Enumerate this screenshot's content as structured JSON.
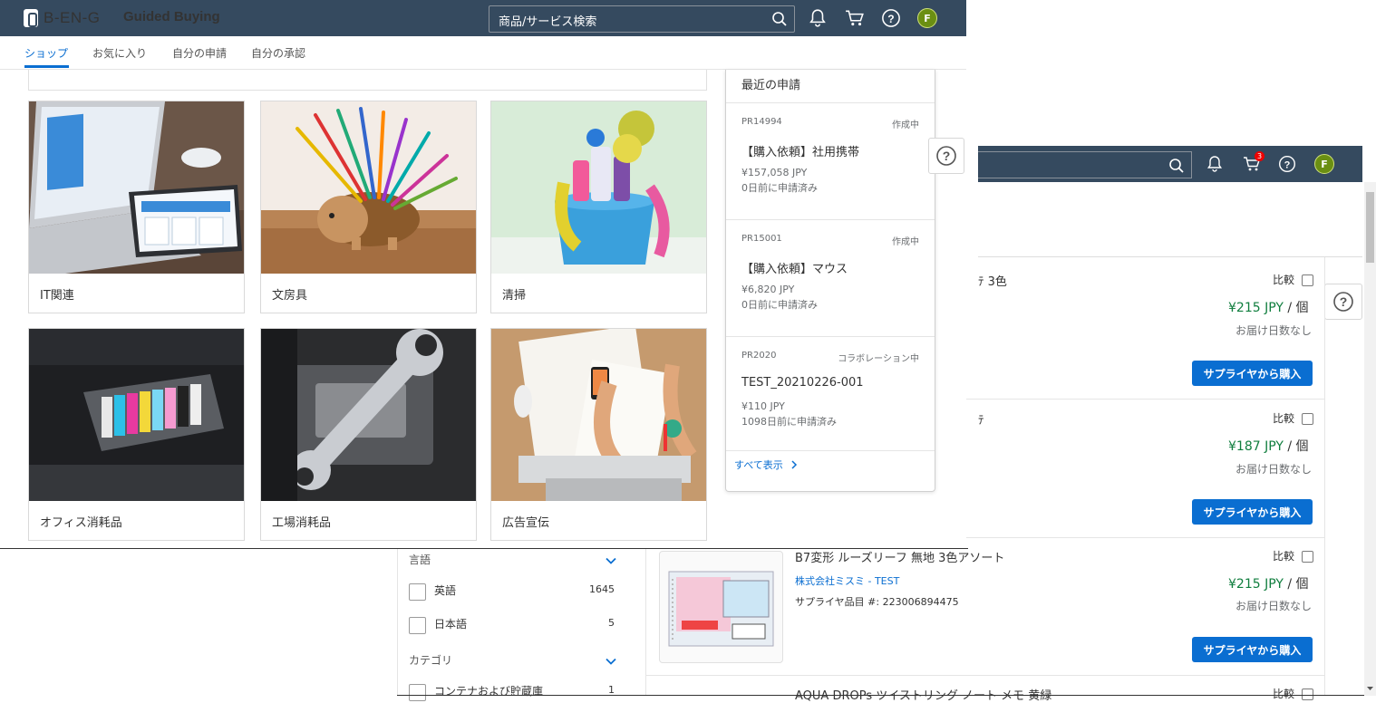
{
  "app": {
    "brand": "B-EN-G",
    "product": "Guided Buying",
    "search_placeholder": "商品/サービス検索",
    "avatar_initial": "F",
    "cart_badge": "3"
  },
  "nav": {
    "tabs": [
      {
        "label": "ショップ",
        "active": true
      },
      {
        "label": "お気に入り"
      },
      {
        "label": "自分の申請"
      },
      {
        "label": "自分の承認"
      }
    ]
  },
  "categories": [
    {
      "label": "IT関連",
      "icon": "laptop-image"
    },
    {
      "label": "文房具",
      "icon": "pencils-image"
    },
    {
      "label": "清掃",
      "icon": "cleaning-supplies-image"
    },
    {
      "label": "オフィス消耗品",
      "icon": "printer-ink-image"
    },
    {
      "label": "工場消耗品",
      "icon": "wrench-engine-image"
    },
    {
      "label": "広告宣伝",
      "icon": "design-desk-image"
    }
  ],
  "recent": {
    "heading": "最近の申請",
    "items": [
      {
        "id": "PR14994",
        "status": "作成中",
        "title": "【購入依頼】社用携帯",
        "amount": "¥157,058 JPY",
        "date": "0日前に申請済み"
      },
      {
        "id": "PR15001",
        "status": "作成中",
        "title": "【購入依頼】マウス",
        "amount": "¥6,820 JPY",
        "date": "0日前に申請済み"
      },
      {
        "id": "PR2020",
        "status": "コラボレーション中",
        "title": "TEST_20210226-001",
        "amount": "¥110 JPY",
        "date": "1098日前に申請済み"
      }
    ],
    "show_all": "すべて表示"
  },
  "back": {
    "products": [
      {
        "title_partial": "ﾃ 3色",
        "compare": "比較",
        "price": "¥215 JPY",
        "unit": " / 個",
        "delivery": "お届け日数なし",
        "buy": "サプライヤから購入"
      },
      {
        "title_partial": "ﾃ",
        "compare": "比較",
        "price": "¥187 JPY",
        "unit": " / 個",
        "delivery": "お届け日数なし",
        "buy": "サプライヤから購入"
      },
      {
        "title": "B7変形 ルーズリーフ 無地 3色アソート",
        "supplier": "株式会社ミスミ - TEST",
        "sku": "サプライヤ品目 #: 223006894475",
        "compare": "比較",
        "price": "¥215 JPY",
        "unit": " / 個",
        "delivery": "お届け日数なし",
        "buy": "サプライヤから購入"
      },
      {
        "title": "AQUA DROPs ツイストリング ノート メモ 黄緑",
        "compare": "比較"
      }
    ],
    "filters": [
      {
        "heading": "言語",
        "options": [
          {
            "label": "英語",
            "count": "1645"
          },
          {
            "label": "日本語",
            "count": "5"
          }
        ]
      },
      {
        "heading": "カテゴリ",
        "options": [
          {
            "label": "コンテナおよび貯蔵庫",
            "count": "1"
          }
        ]
      }
    ]
  }
}
